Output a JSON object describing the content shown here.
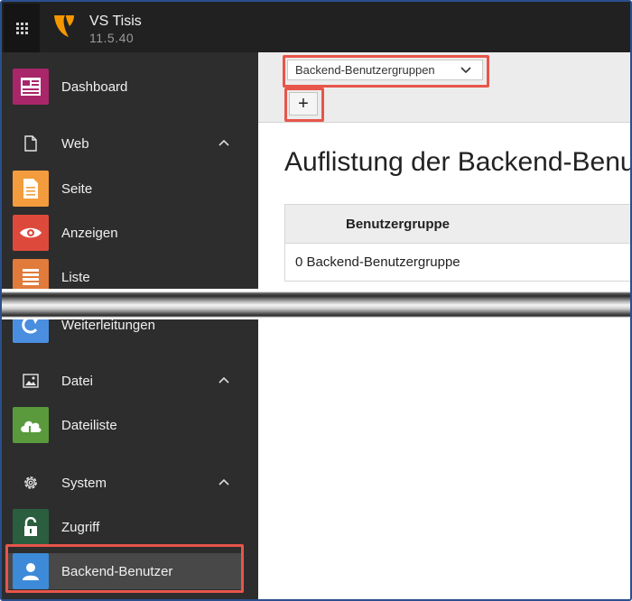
{
  "header": {
    "site_name": "VS Tisis",
    "version": "11.5.40"
  },
  "sidebar": {
    "items": [
      {
        "label": "Dashboard",
        "icon": "dashboard-icon",
        "color": "#a9266a"
      },
      {
        "label": "Web",
        "icon": "page-icon",
        "group": true
      },
      {
        "label": "Seite",
        "icon": "page-module-icon",
        "color": "#f39c3d"
      },
      {
        "label": "Anzeigen",
        "icon": "eye-icon",
        "color": "#dd4a3c"
      },
      {
        "label": "Liste",
        "icon": "list-icon",
        "color": "#e07b3b"
      },
      {
        "label": "Weiterleitungen",
        "icon": "redirect-icon",
        "color": "#4a8ee0"
      },
      {
        "label": "Datei",
        "icon": "image-icon",
        "group": true
      },
      {
        "label": "Dateiliste",
        "icon": "cloud-folder-icon",
        "color": "#5a9a3c"
      },
      {
        "label": "System",
        "icon": "gear-icon",
        "group": true
      },
      {
        "label": "Zugriff",
        "icon": "lock-icon",
        "color": "#2b5e3e"
      },
      {
        "label": "Backend-Benutzer",
        "icon": "user-icon",
        "color": "#3d8ad9",
        "active": true
      }
    ]
  },
  "docheader": {
    "dropdown_value": "Backend-Benutzergruppen",
    "add_button": "+"
  },
  "main": {
    "title": "Auflistung der Backend-Benutzergruppen",
    "table": {
      "column_header": "Benutzergruppe",
      "rows": [
        "0 Backend-Benutzergruppe"
      ]
    }
  },
  "colors": {
    "topbar": "#212121",
    "sidebar": "#2d2d2d",
    "highlight": "#e8554a",
    "typo3_orange": "#f49700"
  }
}
